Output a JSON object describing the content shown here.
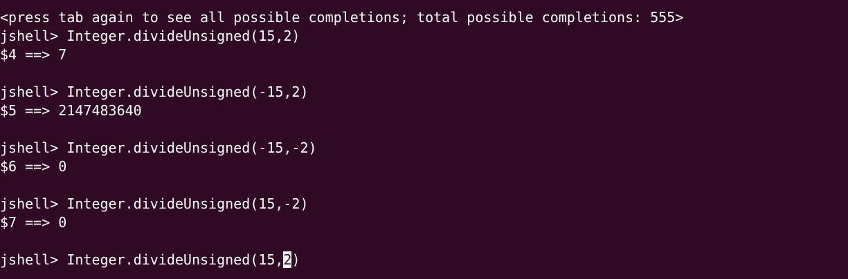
{
  "terminal": {
    "background": "#300a24",
    "foreground": "#ffffff",
    "lines": {
      "l0": "<press tab again to see all possible completions; total possible completions: 555>",
      "l1": "jshell> Integer.divideUnsigned(15,2)",
      "l2": "$4 ==> 7",
      "l3": "",
      "l4": "jshell> Integer.divideUnsigned(-15,2)",
      "l5": "$5 ==> 2147483640",
      "l6": "",
      "l7": "jshell> Integer.divideUnsigned(-15,-2)",
      "l8": "$6 ==> 0",
      "l9": "",
      "l10": "jshell> Integer.divideUnsigned(15,-2)",
      "l11": "$7 ==> 0",
      "l12": ""
    },
    "current_input": {
      "prefix": "jshell> Integer.divideUnsigned(15,",
      "cursor_char": "2",
      "suffix": ")"
    }
  }
}
